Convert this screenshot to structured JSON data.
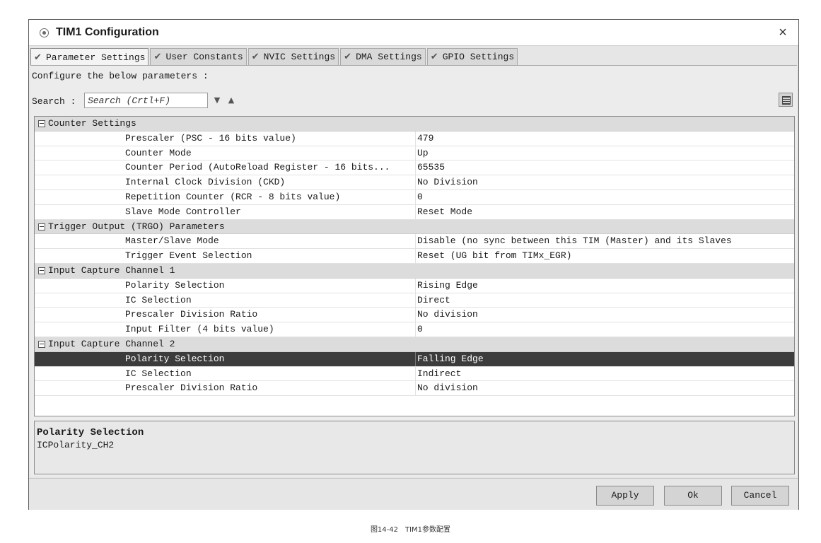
{
  "window": {
    "title": "TIM1 Configuration",
    "close_glyph": "×"
  },
  "tabs": [
    {
      "label": "Parameter Settings",
      "active": true
    },
    {
      "label": "User Constants",
      "active": false
    },
    {
      "label": "NVIC Settings",
      "active": false
    },
    {
      "label": "DMA Settings",
      "active": false
    },
    {
      "label": "GPIO Settings",
      "active": false
    }
  ],
  "panel": {
    "configure_label": "Configure the below parameters :",
    "search_label": "Search :",
    "search_placeholder": "Search (Crtl+F)"
  },
  "groups": [
    {
      "label": "Counter Settings",
      "params": [
        {
          "name": "Prescaler (PSC - 16 bits value)",
          "value": "479"
        },
        {
          "name": "Counter Mode",
          "value": "Up"
        },
        {
          "name": "Counter Period (AutoReload Register - 16 bits...",
          "value": "65535"
        },
        {
          "name": "Internal Clock Division (CKD)",
          "value": "No Division"
        },
        {
          "name": "Repetition Counter (RCR - 8 bits value)",
          "value": "0"
        },
        {
          "name": "Slave Mode Controller",
          "value": "Reset Mode"
        }
      ]
    },
    {
      "label": "Trigger Output (TRGO) Parameters",
      "params": [
        {
          "name": "Master/Slave Mode",
          "value": "Disable (no sync between this TIM (Master) and its Slaves"
        },
        {
          "name": "Trigger Event Selection",
          "value": "Reset (UG bit from TIMx_EGR)"
        }
      ]
    },
    {
      "label": "Input Capture Channel 1",
      "params": [
        {
          "name": "Polarity Selection",
          "value": "Rising Edge"
        },
        {
          "name": "IC Selection",
          "value": "Direct"
        },
        {
          "name": "Prescaler Division Ratio",
          "value": "No division"
        },
        {
          "name": "Input Filter (4 bits value)",
          "value": "0"
        }
      ]
    },
    {
      "label": "Input Capture Channel 2",
      "params": [
        {
          "name": "Polarity Selection",
          "value": "Falling Edge",
          "selected": true
        },
        {
          "name": "IC Selection",
          "value": "Indirect"
        },
        {
          "name": "Prescaler Division Ratio",
          "value": "No division"
        }
      ]
    }
  ],
  "description": {
    "title": "Polarity Selection",
    "text": "ICPolarity_CH2"
  },
  "buttons": {
    "apply": "Apply",
    "ok": "Ok",
    "cancel": "Cancel"
  },
  "caption": "图14-42　TIM1参数配置",
  "icons": {
    "tab_check": "check-icon",
    "search_down": "arrow-down-icon",
    "search_up": "arrow-up-icon",
    "expand_toggle": "group-collapse-icon",
    "view_toggle": "grid-view-icon",
    "app": "app-icon",
    "close": "close-icon"
  }
}
